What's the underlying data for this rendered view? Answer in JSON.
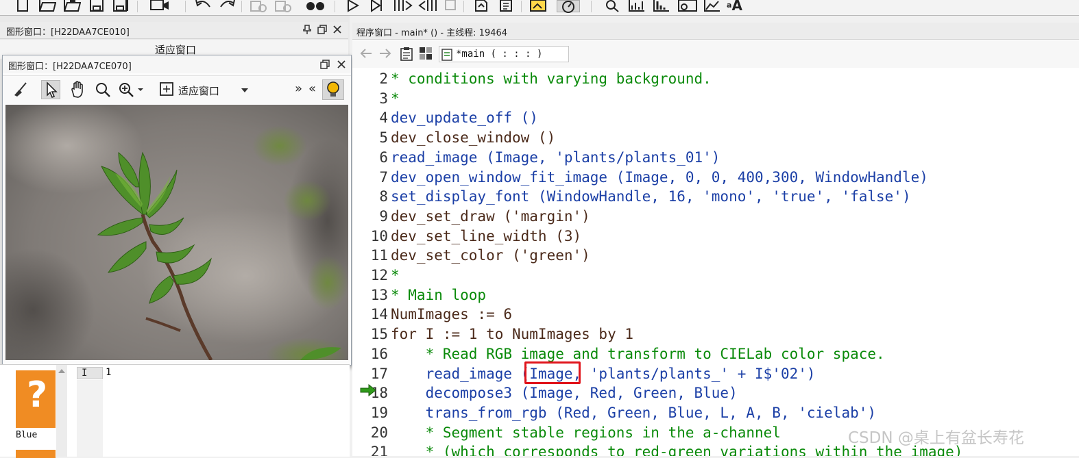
{
  "toolbar": {
    "icons": [
      "new-file-icon",
      "open-icon",
      "open-recent-icon",
      "save-icon",
      "save-all-icon",
      "camera-icon",
      "undo-icon",
      "redo-icon",
      "check-disabled-icon",
      "check-disabled-icon-2",
      "binoculars-icon",
      "run-icon",
      "step-over-icon",
      "step-into-icon",
      "step-out-icon",
      "stop-icon",
      "reset-icon",
      "document-icon",
      "image-highlight-icon",
      "speedometer-icon",
      "search-icon",
      "chart-icon",
      "histogram-icon",
      "line-profile-icon",
      "plot-icon",
      "font-icon"
    ],
    "font_button_label": "A"
  },
  "graphics_window_1": {
    "title": "图形窗口：[H22DAA7CE010]",
    "partial_fit_label": "适应窗口"
  },
  "graphics_window_2": {
    "title": "图形窗口：[H22DAA7CE070]",
    "fit_label": "适应窗口",
    "forward_label": "»",
    "back_label": "«"
  },
  "variable_panel": {
    "help_glyph": "?",
    "channel_label": "Blue",
    "grid_header": "I",
    "grid_value": "1"
  },
  "program_window": {
    "title": "程序窗口 - main* () - 主线程: 19464",
    "procedure_combo": "*main ( : : : )",
    "lines": [
      {
        "n": "2",
        "text": "* conditions with varying background.",
        "kind": "cm"
      },
      {
        "n": "3",
        "text": "*",
        "kind": "cm"
      },
      {
        "n": "4",
        "text": "dev_update_off ()",
        "kind": "op"
      },
      {
        "n": "5",
        "text": "dev_close_window ()",
        "kind": "ctl"
      },
      {
        "n": "6",
        "text": "read_image (Image, 'plants/plants_01')",
        "kind": "op"
      },
      {
        "n": "7",
        "text": "dev_open_window_fit_image (Image, 0, 0, 400,300, WindowHandle)",
        "kind": "op"
      },
      {
        "n": "8",
        "text": "set_display_font (WindowHandle, 16, 'mono', 'true', 'false')",
        "kind": "op"
      },
      {
        "n": "9",
        "text": "dev_set_draw ('margin')",
        "kind": "ctl"
      },
      {
        "n": "10",
        "text": "dev_set_line_width (3)",
        "kind": "ctl"
      },
      {
        "n": "11",
        "text": "dev_set_color ('green')",
        "kind": "ctl"
      },
      {
        "n": "12",
        "text": "*",
        "kind": "cm"
      },
      {
        "n": "13",
        "text": "* Main loop",
        "kind": "cm"
      },
      {
        "n": "14",
        "text": "NumImages := 6",
        "kind": "ctl"
      },
      {
        "n": "15",
        "text": "for I := 1 to NumImages by 1",
        "kind": "ctl"
      },
      {
        "n": "16",
        "text": "    * Read RGB image and transform to CIELab color space.",
        "kind": "cm"
      },
      {
        "n": "17",
        "text": "    read_image (Image, 'plants/plants_' + I$'02')",
        "kind": "op"
      },
      {
        "n": "18",
        "text": "    decompose3 (Image, Red, Green, Blue)",
        "kind": "op"
      },
      {
        "n": "19",
        "text": "    trans_from_rgb (Red, Green, Blue, L, A, B, 'cielab')",
        "kind": "op"
      },
      {
        "n": "20",
        "text": "    * Segment stable regions in the a-channel",
        "kind": "cm"
      },
      {
        "n": "21",
        "text": "    * (which corresponds to red-green variations within the image)",
        "kind": "cm"
      }
    ]
  },
  "watermark": "CSDN @桌上有盆长寿花"
}
